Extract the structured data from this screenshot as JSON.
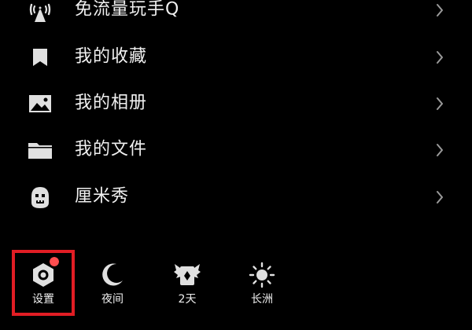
{
  "menu": {
    "items": [
      {
        "label": "免流量玩手Q",
        "icon": "wireless-signal-icon"
      },
      {
        "label": "我的收藏",
        "icon": "bookmark-icon"
      },
      {
        "label": "我的相册",
        "icon": "photo-album-icon"
      },
      {
        "label": "我的文件",
        "icon": "folder-icon"
      },
      {
        "label": "厘米秀",
        "icon": "avatar-show-icon"
      }
    ]
  },
  "bottom_bar": {
    "items": [
      {
        "label": "设置",
        "icon": "settings-icon",
        "has_notification": true
      },
      {
        "label": "夜间",
        "icon": "moon-icon"
      },
      {
        "label": "2天",
        "icon": "winged-card-icon"
      },
      {
        "label": "长洲",
        "icon": "sun-icon"
      }
    ]
  },
  "colors": {
    "background": "#000000",
    "text": "#efefef",
    "icon": "#e0e0e0",
    "highlight": "#e11d24",
    "notification": "#ff4d4f",
    "chevron": "#9a9a9a"
  }
}
